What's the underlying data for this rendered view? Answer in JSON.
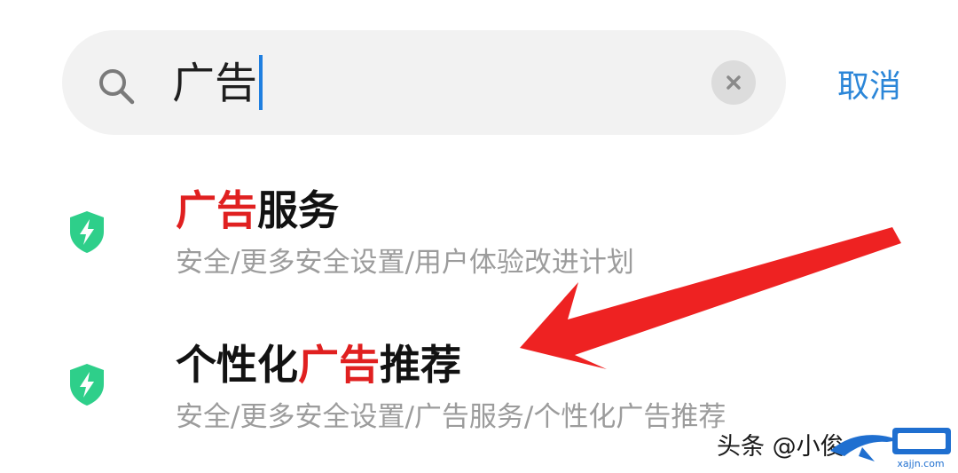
{
  "search": {
    "query": "广告",
    "cancel_label": "取消",
    "icon": "search-icon",
    "clear_icon": "close-icon"
  },
  "results": [
    {
      "title_highlight": "广告",
      "title_rest": "服务",
      "path": "安全/更多安全设置/用户体验改进计划",
      "icon": "shield-bolt-icon"
    },
    {
      "title_prefix": "个性化",
      "title_highlight": "广告",
      "title_rest": "推荐",
      "path": "安全/更多安全设置/广告服务/个性化广告推荐",
      "icon": "shield-bolt-icon"
    }
  ],
  "watermark": {
    "text": "头条 @小俊",
    "logo_text": "xajjn.com"
  },
  "colors": {
    "accent": "#2b86d8",
    "highlight": "#e02020",
    "shield": "#2ecf8a",
    "arrow": "#ee2222"
  }
}
